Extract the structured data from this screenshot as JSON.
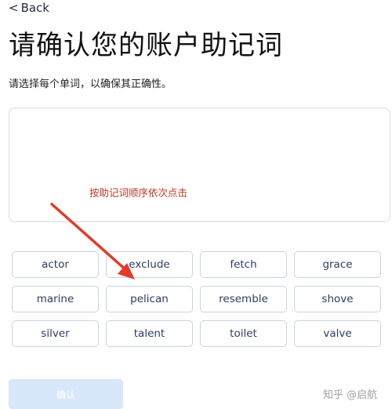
{
  "nav": {
    "back_label": "Back",
    "back_glyph": "<"
  },
  "page": {
    "title": "请确认您的账户助记词",
    "subtitle": "请选择每个单词，以确保其正确性。",
    "hint": "按助记词顺序依次点击"
  },
  "words": [
    "actor",
    "exclude",
    "fetch",
    "grace",
    "marine",
    "pelican",
    "resemble",
    "shove",
    "silver",
    "talent",
    "toilet",
    "valve"
  ],
  "confirm_label": "确认",
  "watermark": {
    "text": "知乎 @启航"
  },
  "annotation": {
    "color": "#e23b2a"
  }
}
